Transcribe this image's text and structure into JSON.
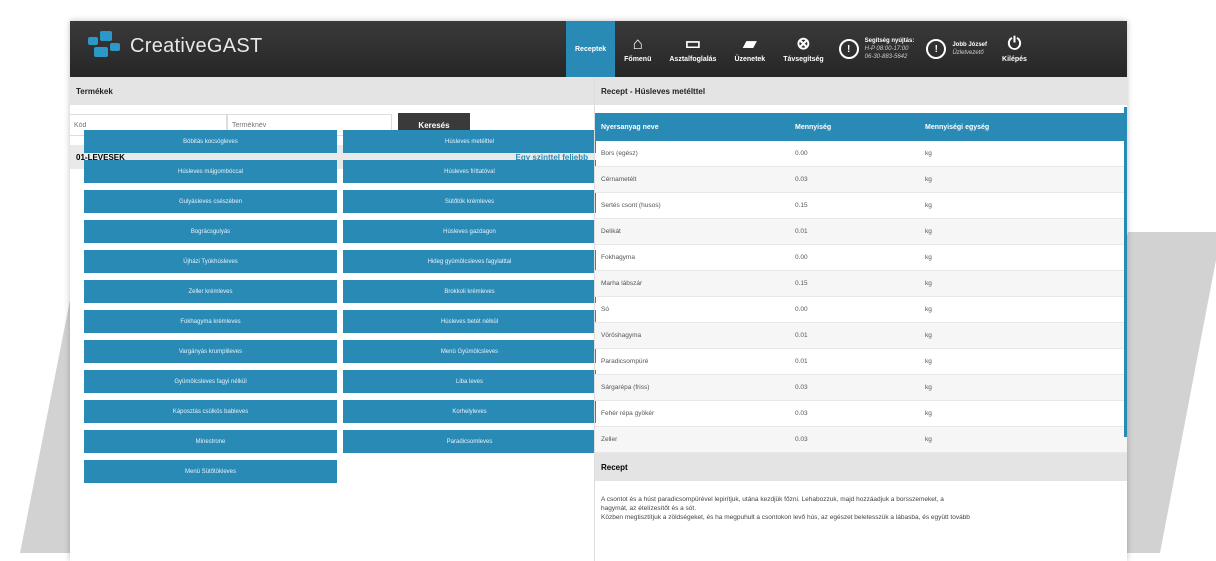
{
  "app": {
    "logo_text": "CreativeGAST"
  },
  "nav": {
    "items": [
      {
        "label": "Receptek",
        "icon": "recipe-icon",
        "active": true
      },
      {
        "label": "Főmenü",
        "icon": "home-icon"
      },
      {
        "label": "Asztalfoglalás",
        "icon": "armchair-icon"
      },
      {
        "label": "Üzenetek",
        "icon": "chat-icon"
      },
      {
        "label": "Távsegítség",
        "icon": "lifebuoy-icon"
      }
    ],
    "support": {
      "line1": "Segítség nyújtás:",
      "line2": "H-P 08:00-17:00",
      "line3": "06-30-883-5642"
    },
    "user": {
      "name": "Jobb József",
      "role": "Üzletvezető"
    },
    "logout_label": "Kilépés"
  },
  "products": {
    "header": "Termékek",
    "code_placeholder": "Kód",
    "name_placeholder": "Terméknév",
    "search_label": "Keresés",
    "category": "01-LEVESEK",
    "up_link": "Egy szinttel feljebb",
    "tiles": [
      "Bóbitás kocsógleves",
      "Húsleves metélttel",
      "Húsleves májgombóccal",
      "Húsleves frittatóval",
      "Gulyásleves csészében",
      "Sütőtök krémleves",
      "Bográcsgulyás",
      "Húsleves gazdagon",
      "Újházi Tyúkhúsleves",
      "Hideg gyümölcsleves fagylalttal",
      "Zeller krémleves",
      "Brokkoli krémleves",
      "Fokhagyma krémleves",
      "Húsleves betét nélkül",
      "Vargányás krumplileves",
      "Menü Gyümölcsleves",
      "Gyümölcsleves fagyi nélkül",
      "Liba leves",
      "Káposztás csülkös bableves",
      "Korhelyleves",
      "Minestrone",
      "Paradicsomleves",
      "Menü Sütőtökleves"
    ]
  },
  "recipe": {
    "header": "Recept - Húsleves metélttel",
    "columns": [
      "Nyersanyag neve",
      "Mennyiség",
      "Mennyiségi egység"
    ],
    "rows": [
      [
        "Bors (egész)",
        "0.00",
        "kg"
      ],
      [
        "Cérnametélt",
        "0.03",
        "kg"
      ],
      [
        "Sertés csont (husos)",
        "0.15",
        "kg"
      ],
      [
        "Delikát",
        "0.01",
        "kg"
      ],
      [
        "Fokhagyma",
        "0.00",
        "kg"
      ],
      [
        "Marha lábszár",
        "0.15",
        "kg"
      ],
      [
        "Só",
        "0.00",
        "kg"
      ],
      [
        "Vöröshagyma",
        "0.01",
        "kg"
      ],
      [
        "Paradicsompüré",
        "0.01",
        "kg"
      ],
      [
        "Sárgarépa (friss)",
        "0.03",
        "kg"
      ],
      [
        "Fehér répa gyökér",
        "0.03",
        "kg"
      ],
      [
        "Zeller",
        "0.03",
        "kg"
      ]
    ],
    "section_header": "Recept",
    "text_line1": "A csontot és a húst paradicsompürével lepirítjuk, utána kezdjük főzni. Lehabozzuk, majd hozzáadjuk a borsszemeket, a",
    "text_line2": "hagymát, az ételízesítőt és a sót.",
    "text_line3": "Közben megtisztítjuk a zöldségeket, és ha megpuhult a csontokon levő hús, az egészet beletesszük a lábasba, és együtt tovább"
  },
  "colors": {
    "accent": "#2a8ab6",
    "topbar": "#2e2e2e"
  }
}
